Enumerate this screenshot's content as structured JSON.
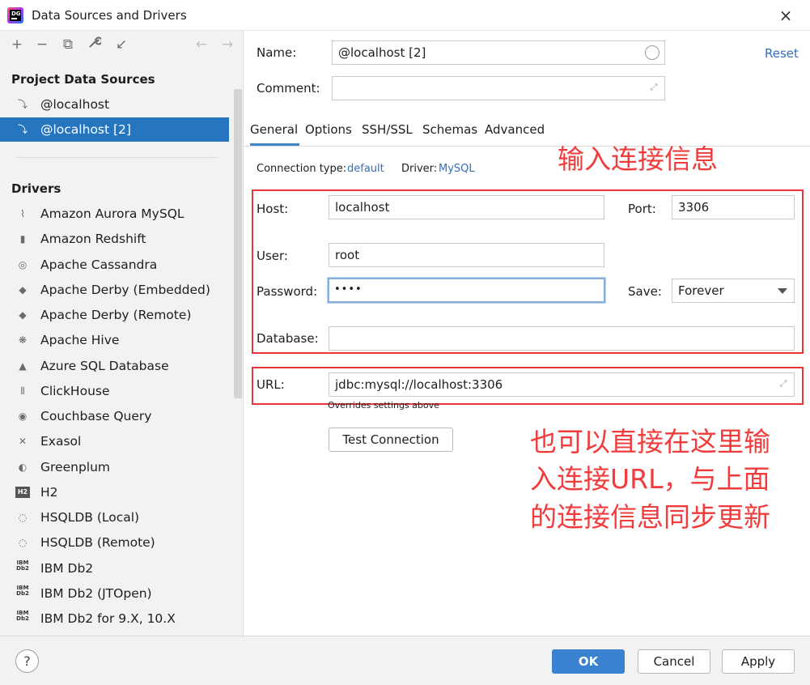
{
  "window": {
    "title": "Data Sources and Drivers",
    "close_icon": "×"
  },
  "toolbar": {
    "add": "+",
    "remove": "−",
    "duplicate": "⧉",
    "settings": "🔧",
    "import": "↙",
    "back": "←",
    "forward": "→"
  },
  "left": {
    "project_header": "Project Data Sources",
    "project_items": [
      {
        "label": "@localhost",
        "icon": "mysql-dolphin-icon"
      },
      {
        "label": "@localhost [2]",
        "icon": "mysql-dolphin-icon",
        "selected": true
      }
    ],
    "drivers_header": "Drivers",
    "drivers": [
      {
        "label": "Amazon Aurora MySQL",
        "icon": "aurora-icon",
        "glyph": "⌇"
      },
      {
        "label": "Amazon Redshift",
        "icon": "redshift-icon",
        "glyph": "▮"
      },
      {
        "label": "Apache Cassandra",
        "icon": "cassandra-icon",
        "glyph": "◎"
      },
      {
        "label": "Apache Derby (Embedded)",
        "icon": "derby-icon",
        "glyph": "◆"
      },
      {
        "label": "Apache Derby (Remote)",
        "icon": "derby-icon",
        "glyph": "◆"
      },
      {
        "label": "Apache Hive",
        "icon": "hive-icon",
        "glyph": "❋"
      },
      {
        "label": "Azure SQL Database",
        "icon": "azure-icon",
        "glyph": "▲"
      },
      {
        "label": "ClickHouse",
        "icon": "clickhouse-icon",
        "glyph": "⦀"
      },
      {
        "label": "Couchbase Query",
        "icon": "couchbase-icon",
        "glyph": "◉"
      },
      {
        "label": "Exasol",
        "icon": "exasol-icon",
        "glyph": "✕"
      },
      {
        "label": "Greenplum",
        "icon": "greenplum-icon",
        "glyph": "◐"
      },
      {
        "label": "H2",
        "icon": "h2-icon",
        "glyph": "H2"
      },
      {
        "label": "HSQLDB (Local)",
        "icon": "hsqldb-icon",
        "glyph": "◌"
      },
      {
        "label": "HSQLDB (Remote)",
        "icon": "hsqldb-icon",
        "glyph": "◌"
      },
      {
        "label": "IBM Db2",
        "icon": "ibm-db2-icon",
        "glyph": "IBM Db2"
      },
      {
        "label": "IBM Db2 (JTOpen)",
        "icon": "ibm-db2-icon",
        "glyph": "IBM Db2"
      },
      {
        "label": "IBM Db2 for 9.X, 10.X",
        "icon": "ibm-db2-icon",
        "glyph": "IBM Db2"
      }
    ]
  },
  "form": {
    "name_label": "Name:",
    "name_value": "@localhost [2]",
    "reset_label": "Reset",
    "comment_label": "Comment:",
    "comment_value": "",
    "tabs": [
      "General",
      "Options",
      "SSH/SSL",
      "Schemas",
      "Advanced"
    ],
    "active_tab": "General",
    "connection_type_label": "Connection type:",
    "connection_type_value": "default",
    "driver_label": "Driver:",
    "driver_value": "MySQL",
    "host_label": "Host:",
    "host_value": "localhost",
    "port_label": "Port:",
    "port_value": "3306",
    "user_label": "User:",
    "user_value": "root",
    "password_label": "Password:",
    "password_value": "••••",
    "save_label": "Save:",
    "save_value": "Forever",
    "database_label": "Database:",
    "database_value": "",
    "url_label": "URL:",
    "url_value": "jdbc:mysql://localhost:3306",
    "url_hint": "Overrides settings above",
    "test_connection": "Test Connection"
  },
  "annotations": {
    "top": "输入连接信息",
    "bottom_lines": [
      "也可以直接在这里输",
      "入连接URL，与上面",
      "的连接信息同步更新"
    ],
    "color": "#f23b3b"
  },
  "buttons": {
    "help": "?",
    "ok": "OK",
    "cancel": "Cancel",
    "apply": "Apply"
  },
  "colors": {
    "selection": "#2675bf",
    "link": "#2f6fc0",
    "primary": "#3a81d0",
    "annotation_box": "#e8373c"
  }
}
